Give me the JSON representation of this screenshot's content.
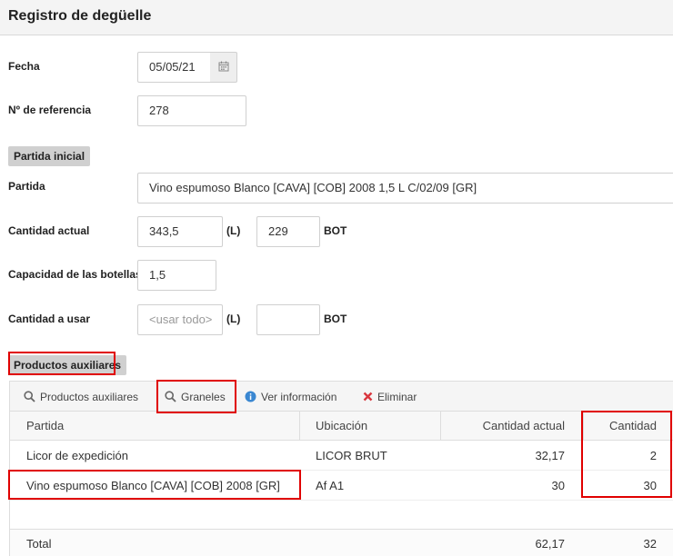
{
  "title": "Registro de degüelle",
  "form": {
    "fecha_label": "Fecha",
    "fecha_value": "05/05/21",
    "referencia_label": "Nº de referencia",
    "referencia_value": "278",
    "partida_inicial_label": "Partida inicial",
    "partida_label": "Partida",
    "partida_value": "Vino espumoso Blanco [CAVA] [COB] 2008 1,5 L C/02/09 [GR]",
    "cantidad_actual_label": "Cantidad actual",
    "cantidad_actual_litros": "343,5",
    "unit_litros": "(L)",
    "cantidad_actual_botellas": "229",
    "unit_bot": "BOT",
    "capacidad_label": "Capacidad de las botellas",
    "capacidad_value": "1,5",
    "cantidad_usar_label": "Cantidad a usar",
    "cantidad_usar_placeholder": "<usar todo>",
    "cantidad_usar_botellas": ""
  },
  "productos_auxiliares_label": "Productos auxiliares",
  "toolbar": {
    "productos_auxiliares": "Productos auxiliares",
    "graneles": "Graneles",
    "ver_informacion": "Ver información",
    "eliminar": "Eliminar"
  },
  "table": {
    "columns": [
      "Partida",
      "Ubicación",
      "Cantidad actual",
      "Cantidad"
    ],
    "rows": [
      {
        "partida": "Licor de expedición",
        "ubicacion": "LICOR BRUT",
        "cantidad_actual": "32,17",
        "cantidad": "2"
      },
      {
        "partida": "Vino espumoso Blanco [CAVA] [COB] 2008 [GR]",
        "ubicacion": "Af A1",
        "cantidad_actual": "30",
        "cantidad": "30"
      }
    ],
    "footer": {
      "label": "Total",
      "cantidad_actual": "62,17",
      "cantidad": "32"
    }
  },
  "colors": {
    "highlight": "#e00000",
    "info_icon": "#3a87d1",
    "delete_icon": "#d9363e"
  },
  "icons": {
    "calendar": "calendar-icon",
    "search": "search-icon",
    "info": "info-icon",
    "delete": "close-icon"
  }
}
